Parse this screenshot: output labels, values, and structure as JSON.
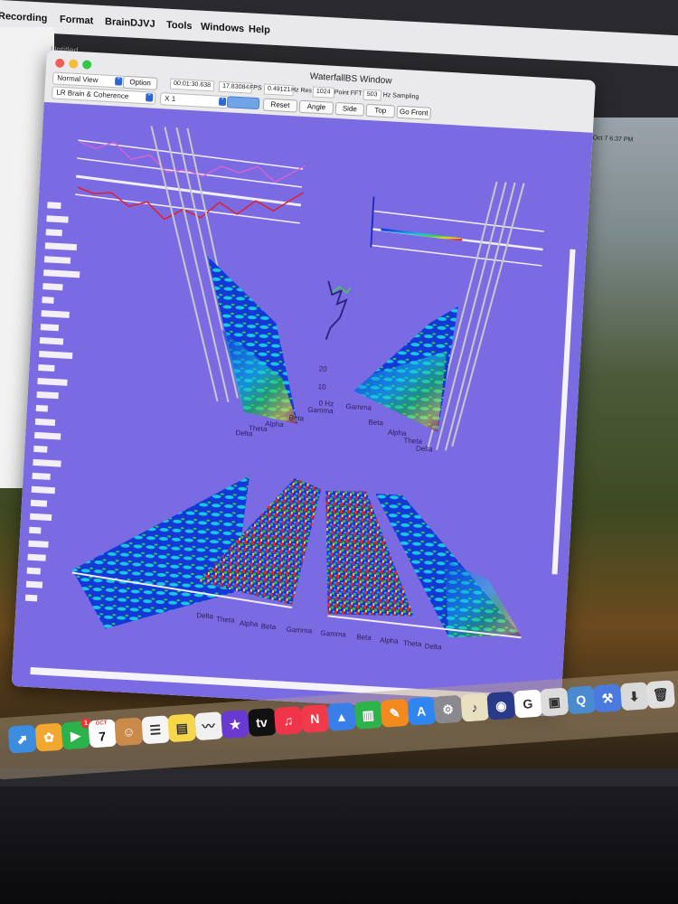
{
  "menubar": {
    "items": [
      "Recording",
      "Format",
      "BrainDJVJ",
      "Tools",
      "Windows",
      "Help"
    ],
    "clock": "Mon Oct 7  6:37 PM"
  },
  "background_window": {
    "title": "Untitled"
  },
  "window": {
    "title": "WaterfallBS Window",
    "view_select": "Normal View",
    "option_button": "Option",
    "mode_select": "LR Brain & Coherence",
    "zoom_select": "X 1",
    "time_readout": "00:01:30.638",
    "fps_value": "17.83084",
    "fps_label": "FPS",
    "hz_res_value": "0.49121",
    "hz_res_label": "Hz Res",
    "fft_value": "1024",
    "fft_label": "Point FFT",
    "sampling_value": "503",
    "sampling_label": "Hz Sampling",
    "buttons": {
      "reset": "Reset",
      "angle": "Angle",
      "side": "Side",
      "top": "Top",
      "front": "Go Front"
    }
  },
  "canvas": {
    "top_left_labels": [
      "20",
      "10",
      "0 Hz",
      "Gamma",
      "Beta",
      "Alpha",
      "Theta",
      "Delta"
    ],
    "top_right_labels": [
      "Gamma",
      "Beta",
      "Alpha",
      "Theta",
      "Delta"
    ],
    "bottom_labels": [
      "Delta",
      "Theta",
      "Alpha",
      "Beta",
      "Gamma",
      "Gamma",
      "Beta",
      "Alpha",
      "Theta",
      "Delta"
    ],
    "side_bar_levels": [
      0.35,
      0.55,
      0.4,
      0.8,
      0.65,
      0.9,
      0.5,
      0.3,
      0.7,
      0.45,
      0.6,
      0.85,
      0.4,
      0.75,
      0.55,
      0.3,
      0.5,
      0.65,
      0.35,
      0.7,
      0.45,
      0.6,
      0.4,
      0.55,
      0.3,
      0.5,
      0.45,
      0.35,
      0.4,
      0.3
    ]
  },
  "dock": {
    "icons": [
      {
        "name": "maps-icon",
        "glyph": "⬈",
        "color": "#3b8de0"
      },
      {
        "name": "photos-icon",
        "glyph": "✿",
        "color": "#f2a72e"
      },
      {
        "name": "facetime-icon",
        "glyph": "▶",
        "color": "#29b34a",
        "badge": "1"
      },
      {
        "name": "calendar-icon",
        "month": "OCT",
        "day": "7"
      },
      {
        "name": "contacts-icon",
        "glyph": "☺",
        "color": "#c98a4a"
      },
      {
        "name": "reminders-icon",
        "glyph": "☰",
        "color": "#f5f5f5"
      },
      {
        "name": "notes-icon",
        "glyph": "▤",
        "color": "#f7d74a"
      },
      {
        "name": "freeform-icon",
        "glyph": "〰",
        "color": "#f0f0f0"
      },
      {
        "name": "imovie-icon",
        "glyph": "★",
        "color": "#6a3ad0"
      },
      {
        "name": "apple-tv-icon",
        "glyph": "tv",
        "color": "#111111"
      },
      {
        "name": "music-icon",
        "glyph": "♫",
        "color": "#f0344a"
      },
      {
        "name": "news-icon",
        "glyph": "N",
        "color": "#f03a4a"
      },
      {
        "name": "keynote-icon",
        "glyph": "▲",
        "color": "#3a7ee8"
      },
      {
        "name": "numbers-icon",
        "glyph": "▥",
        "color": "#2eb34a"
      },
      {
        "name": "pages-icon",
        "glyph": "✎",
        "color": "#f28a1e"
      },
      {
        "name": "app-store-icon",
        "glyph": "A",
        "color": "#2f86f0"
      },
      {
        "name": "system-settings-icon",
        "glyph": "⚙",
        "color": "#8a8a8e"
      },
      {
        "name": "audio-app-icon",
        "glyph": "♪",
        "color": "#e8e0c0"
      },
      {
        "name": "braindjvj-icon",
        "glyph": "◉",
        "color": "#2a3a8a"
      },
      {
        "name": "google-chrome-icon",
        "glyph": "G",
        "color": "#ffffff"
      },
      {
        "name": "preview-icon",
        "glyph": "▣",
        "color": "#dcdcdc"
      },
      {
        "name": "quicktime-icon",
        "glyph": "Q",
        "color": "#4a8ad0"
      },
      {
        "name": "xcode-icon",
        "glyph": "⚒",
        "color": "#4a7ae0"
      },
      {
        "name": "downloads-icon",
        "glyph": "⬇",
        "color": "#d9d9d9"
      },
      {
        "name": "trash-icon",
        "glyph": "🗑",
        "color": "#e0e0e0"
      }
    ]
  }
}
